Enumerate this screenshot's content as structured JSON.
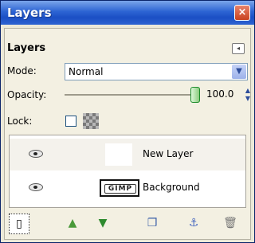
{
  "window": {
    "title": "Layers",
    "close_glyph": "×"
  },
  "dock": {
    "header": "Layers",
    "menu_icon": "tab-menu-icon"
  },
  "mode": {
    "label": "Mode:",
    "value": "Normal"
  },
  "opacity": {
    "label": "Opacity:",
    "value": "100.0",
    "level_percent": 100
  },
  "lock": {
    "label": "Lock:",
    "pixels_locked": false,
    "alpha_locked": false
  },
  "layers": [
    {
      "name": "New Layer",
      "visible": true,
      "thumbnail": "blank-white"
    },
    {
      "name": "Background",
      "visible": true,
      "thumbnail": "gimp-logo",
      "thumbnail_text": "GIMP"
    }
  ],
  "toolbar": {
    "buttons": [
      {
        "name": "new-layer-button",
        "icon": "new-layer-icon"
      },
      {
        "name": "raise-layer-button",
        "icon": "raise-arrow-icon"
      },
      {
        "name": "lower-layer-button",
        "icon": "lower-arrow-icon"
      },
      {
        "name": "duplicate-layer-button",
        "icon": "duplicate-icon"
      },
      {
        "name": "anchor-layer-button",
        "icon": "anchor-icon"
      },
      {
        "name": "delete-layer-button",
        "icon": "trash-icon"
      }
    ]
  },
  "colors": {
    "titlebar": "#2c64d3",
    "close": "#c9421f",
    "panel": "#ece9d8"
  }
}
